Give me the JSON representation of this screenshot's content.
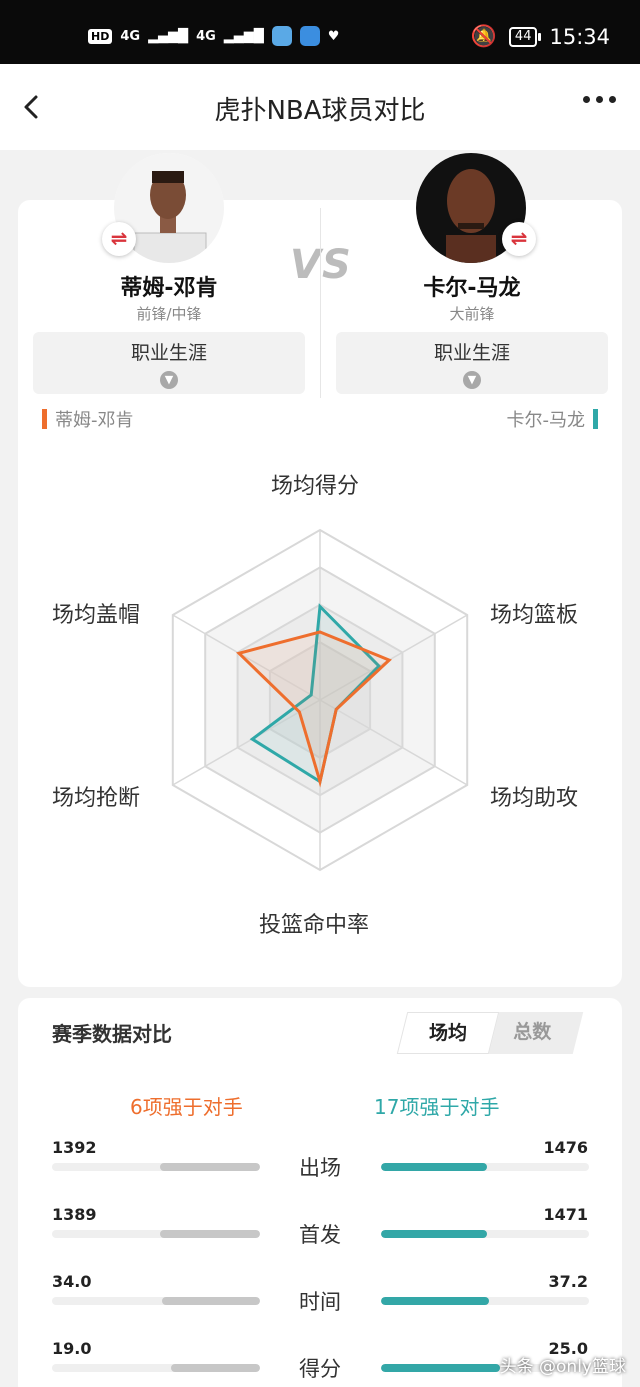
{
  "status_bar": {
    "hd": "HD",
    "net1": "4G",
    "net2": "4G",
    "battery": "44",
    "time": "15:34"
  },
  "nav": {
    "title": "虎扑NBA球员对比"
  },
  "compare": {
    "vs": "VS",
    "player1": {
      "name": "蒂姆-邓肯",
      "position": "前锋/中锋",
      "career": "职业生涯",
      "legend": "蒂姆-邓肯",
      "color": "#ee6e2d"
    },
    "player2": {
      "name": "卡尔-马龙",
      "position": "大前锋",
      "career": "职业生涯",
      "legend": "卡尔-马龙",
      "color": "#2fa8a8"
    }
  },
  "radar": {
    "labels": {
      "points": "场均得分",
      "rebounds": "场均篮板",
      "assists": "场均助攻",
      "fg_pct": "投篮命中率",
      "steals": "场均抢断",
      "blocks": "场均盖帽"
    },
    "player1_values": [
      0.4,
      0.47,
      0.11,
      0.48,
      0.14,
      0.55
    ],
    "player2_values": [
      0.55,
      0.4,
      0.11,
      0.48,
      0.46,
      0.06
    ]
  },
  "season": {
    "title": "赛季数据对比",
    "tab_avg": "场均",
    "tab_total": "总数",
    "left_summary": "6项强于对手",
    "right_summary": "17项强于对手",
    "rows": [
      {
        "label": "出场",
        "left": "1392",
        "right": "1476",
        "left_pct": 0.48,
        "right_pct": 0.51
      },
      {
        "label": "首发",
        "left": "1389",
        "right": "1471",
        "left_pct": 0.48,
        "right_pct": 0.51
      },
      {
        "label": "时间",
        "left": "34.0",
        "right": "37.2",
        "left_pct": 0.47,
        "right_pct": 0.52
      },
      {
        "label": "得分",
        "left": "19.0",
        "right": "25.0",
        "left_pct": 0.43,
        "right_pct": 0.57
      }
    ]
  },
  "watermark": "头条 @only篮球"
}
